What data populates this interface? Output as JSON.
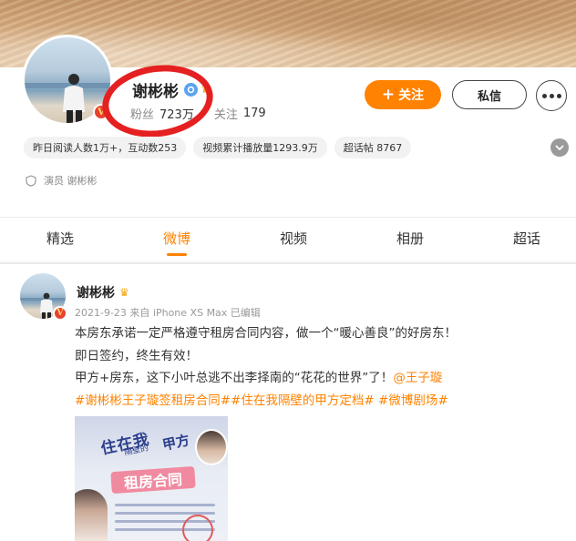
{
  "profile": {
    "name": "谢彬彬",
    "v_badge": "V",
    "fans_label": "粉丝",
    "fans_count": "723万",
    "following_label": "关注",
    "following_count": "179",
    "follow_button": "关注",
    "follow_button_prefix": "+",
    "message_button": "私信",
    "pills": [
      "昨日阅读人数1万+，互动数253",
      "视频累计播放量1293.9万",
      "超话帖 8767"
    ],
    "profession": "演员 谢彬彬"
  },
  "tabs": [
    {
      "label": "精选",
      "active": false
    },
    {
      "label": "微博",
      "active": true
    },
    {
      "label": "视频",
      "active": false
    },
    {
      "label": "相册",
      "active": false
    },
    {
      "label": "超话",
      "active": false
    }
  ],
  "post": {
    "author": "谢彬彬",
    "v_badge": "V",
    "meta": "2021-9-23 来自 iPhone XS Max 已编辑",
    "line1": "本房东承诺一定严格遵守租房合同内容，做一个“暖心善良”的好房东！",
    "line2": "即日签约，终生有效！",
    "line3_text": "甲方+房东，这下小叶总逃不出李择南的“花花的世界”了！",
    "line3_mention": "@王子璇",
    "hashtags": "#谢彬彬王子璇签租房合同##住在我隔壁的甲方定档# #微博剧场#",
    "image": {
      "title": "住在我",
      "subtitle": "隔壁的",
      "title2": "甲方",
      "banner": "租房合同"
    }
  },
  "colors": {
    "accent": "#ff8200",
    "highlight_ring": "#e52020",
    "verified": "#5aa3ee",
    "v_badge": "#e8412c"
  },
  "icons": {
    "verified": "verified-icon",
    "crown": "crown-icon",
    "more": "more-icon",
    "expand": "chevron-down-icon",
    "profession": "shield-icon"
  }
}
